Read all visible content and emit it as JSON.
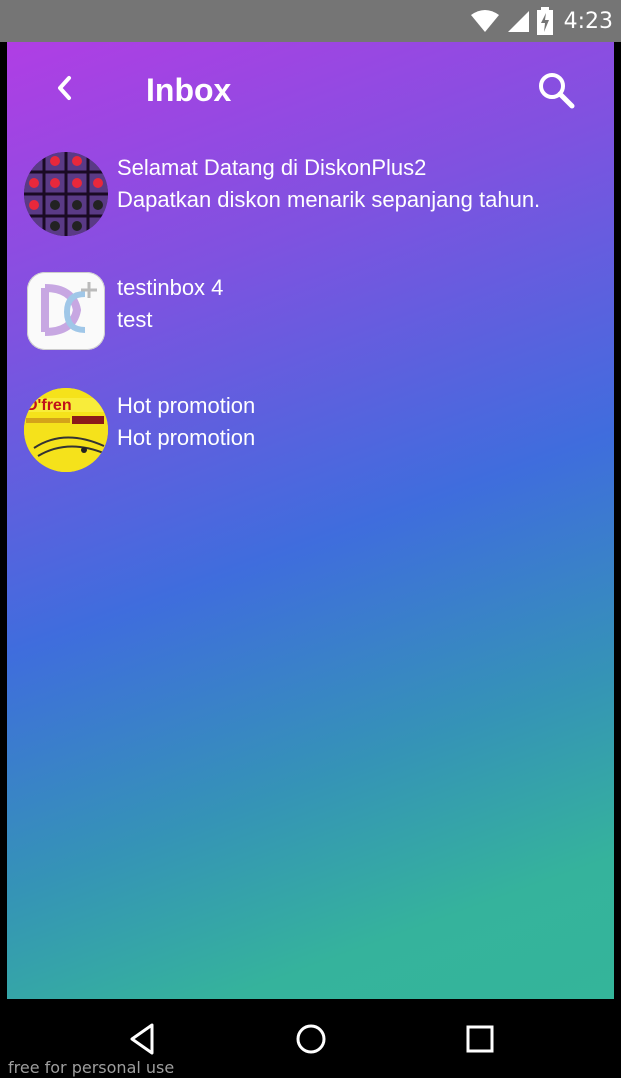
{
  "status": {
    "time": "4:23",
    "wifi_icon": "wifi-icon",
    "signal_icon": "signal-icon",
    "battery_icon": "battery-charging-icon"
  },
  "toolbar": {
    "title": "Inbox",
    "back_icon": "chevron-left-icon",
    "search_icon": "search-icon"
  },
  "messages": [
    {
      "title": "Selamat Datang di DiskonPlus2",
      "body": "Dapatkan diskon menarik sepanjang tahun."
    },
    {
      "title": "testinbox 4",
      "body": "test"
    },
    {
      "title": "Hot promotion",
      "body": "Hot promotion"
    }
  ],
  "navbar": {
    "back_icon": "triangle-back-icon",
    "home_icon": "circle-home-icon",
    "recents_icon": "square-recents-icon"
  },
  "watermark": "free for personal use",
  "colors": {
    "status_bar": "#757575",
    "gradient_top": "#b03ee4",
    "gradient_mid": "#3f6ddd",
    "gradient_bottom": "#34b59a"
  }
}
